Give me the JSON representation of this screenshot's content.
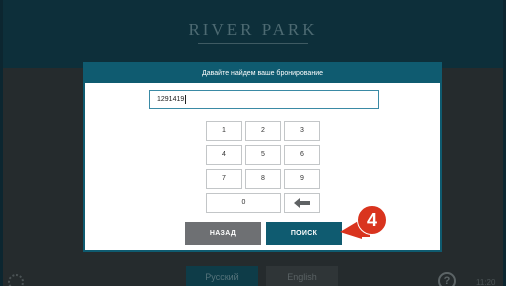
{
  "background": {
    "logo": "RIVER PARK",
    "languages": [
      "Русский",
      "English"
    ],
    "help_glyph": "?",
    "time": "11:20"
  },
  "modal": {
    "title": "Давайте найдем ваше бронирование",
    "input_value": "1291419",
    "keypad": [
      "1",
      "2",
      "3",
      "4",
      "5",
      "6",
      "7",
      "8",
      "9",
      "0"
    ],
    "backspace_icon": "backspace-arrow-icon",
    "back_label": "НАЗАД",
    "search_label": "ПОИСК"
  },
  "marker": {
    "step": "4"
  },
  "colors": {
    "accent": "#0f5b70",
    "back_button": "#6e7073",
    "marker": "#d9341e"
  }
}
